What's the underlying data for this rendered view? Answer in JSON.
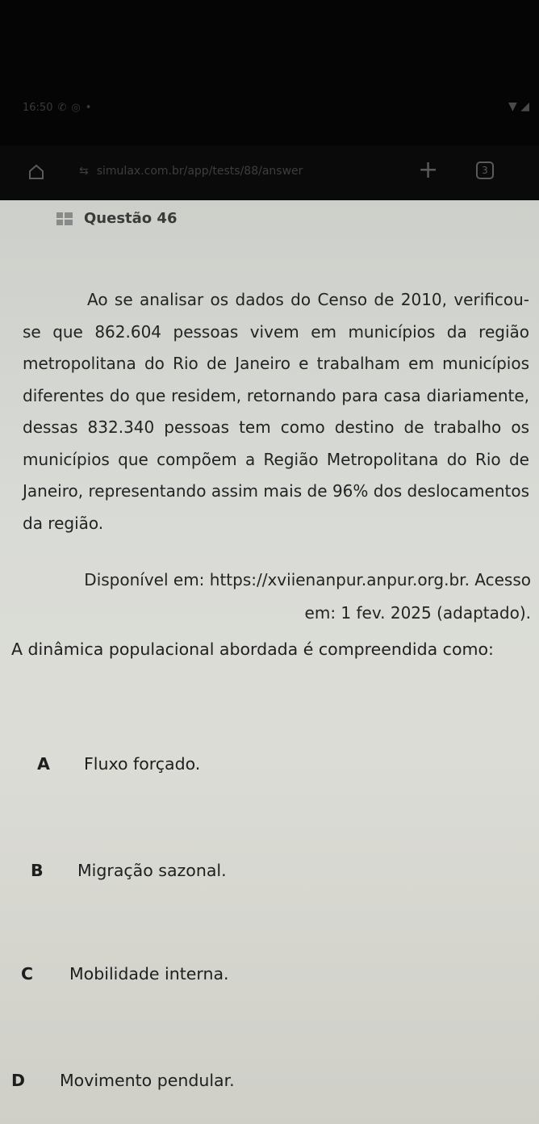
{
  "status_bar": {
    "time": "16:50",
    "icons": [
      "whatsapp-icon",
      "chrome-icon",
      "dot-icon",
      "wifi-icon",
      "signal-icon"
    ]
  },
  "browser": {
    "url": "simulax.com.br/app/tests/88/answer",
    "tab_count": "3",
    "icons": [
      "home-icon",
      "site-settings-icon",
      "plus-icon",
      "tabs-icon"
    ]
  },
  "question": {
    "title": "Questão 46",
    "passage": "Ao se analisar os dados do Censo de 2010, verificou-se que 862.604 pessoas vivem em municípios da região metropolitana do Rio de Janeiro e trabalham em municípios diferentes do que residem, retornando para casa diariamente, dessas 832.340 pessoas tem como destino de trabalho os municípios que compõem a Região Metropolitana do Rio de Janeiro, representando assim mais de 96% dos deslocamentos da região.",
    "source": "Disponível em: https://xviienanpur.anpur.org.br. Acesso em: 1 fev. 2025 (adaptado).",
    "prompt": "A dinâmica populacional abordada é compreendida como:",
    "options": [
      {
        "letter": "A",
        "text": "Fluxo forçado."
      },
      {
        "letter": "B",
        "text": "Migração sazonal."
      },
      {
        "letter": "C",
        "text": "Mobilidade interna."
      },
      {
        "letter": "D",
        "text": "Movimento pendular."
      }
    ]
  }
}
